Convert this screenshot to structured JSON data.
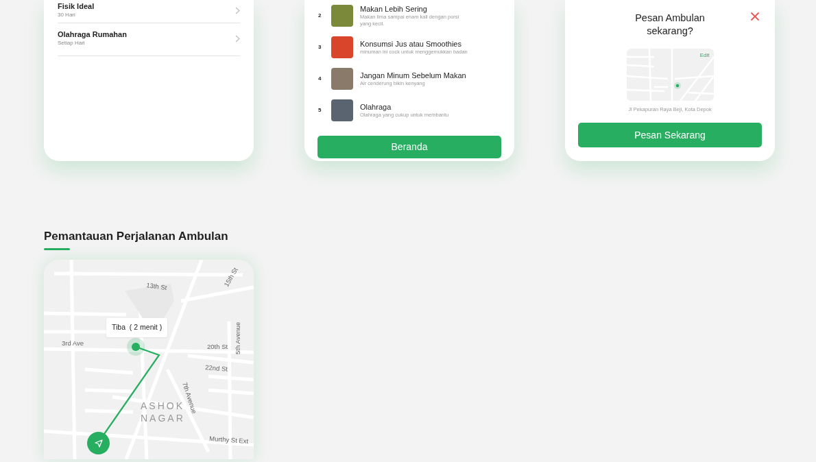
{
  "programs": {
    "items": [
      {
        "title": "Fisik Ideal",
        "subtitle": "30 Hari"
      },
      {
        "title": "Olahraga Rumahan",
        "subtitle": "Setiap Hari"
      }
    ]
  },
  "tips": {
    "items": [
      {
        "number": "2",
        "title": "Makan Lebih Sering",
        "description": "Makan lima sampai enam kali dengan porsi yang kecil."
      },
      {
        "number": "3",
        "title": "Konsumsi Jus atau Smoothies",
        "description": "minuman ini cock untuk menggemukkan badan"
      },
      {
        "number": "4",
        "title": "Jangan Minum Sebelum Makan",
        "description": "Air cenderung bikin kenyang"
      },
      {
        "number": "5",
        "title": "Olahraga",
        "description": "Olahraga yang cukup untuk membantu"
      }
    ],
    "button": "Beranda"
  },
  "order": {
    "title": "Pesan Ambulan sekarang?",
    "map_link": "Edit",
    "address": "Jl Pekapuran Raya Beji, Kota Depok",
    "button": "Pesan Sekarang"
  },
  "tracking": {
    "heading": "Pemantauan Perjalanan Ambulan",
    "eta": "Tiba  ( 2 menit )",
    "street_labels": [
      "13th St",
      "15th St",
      "3rd Ave",
      "20th St",
      "5th Avenue",
      "22nd St",
      "7th Avenue",
      "ASHOK",
      "NAGAR",
      "Murthy St Ext"
    ]
  }
}
